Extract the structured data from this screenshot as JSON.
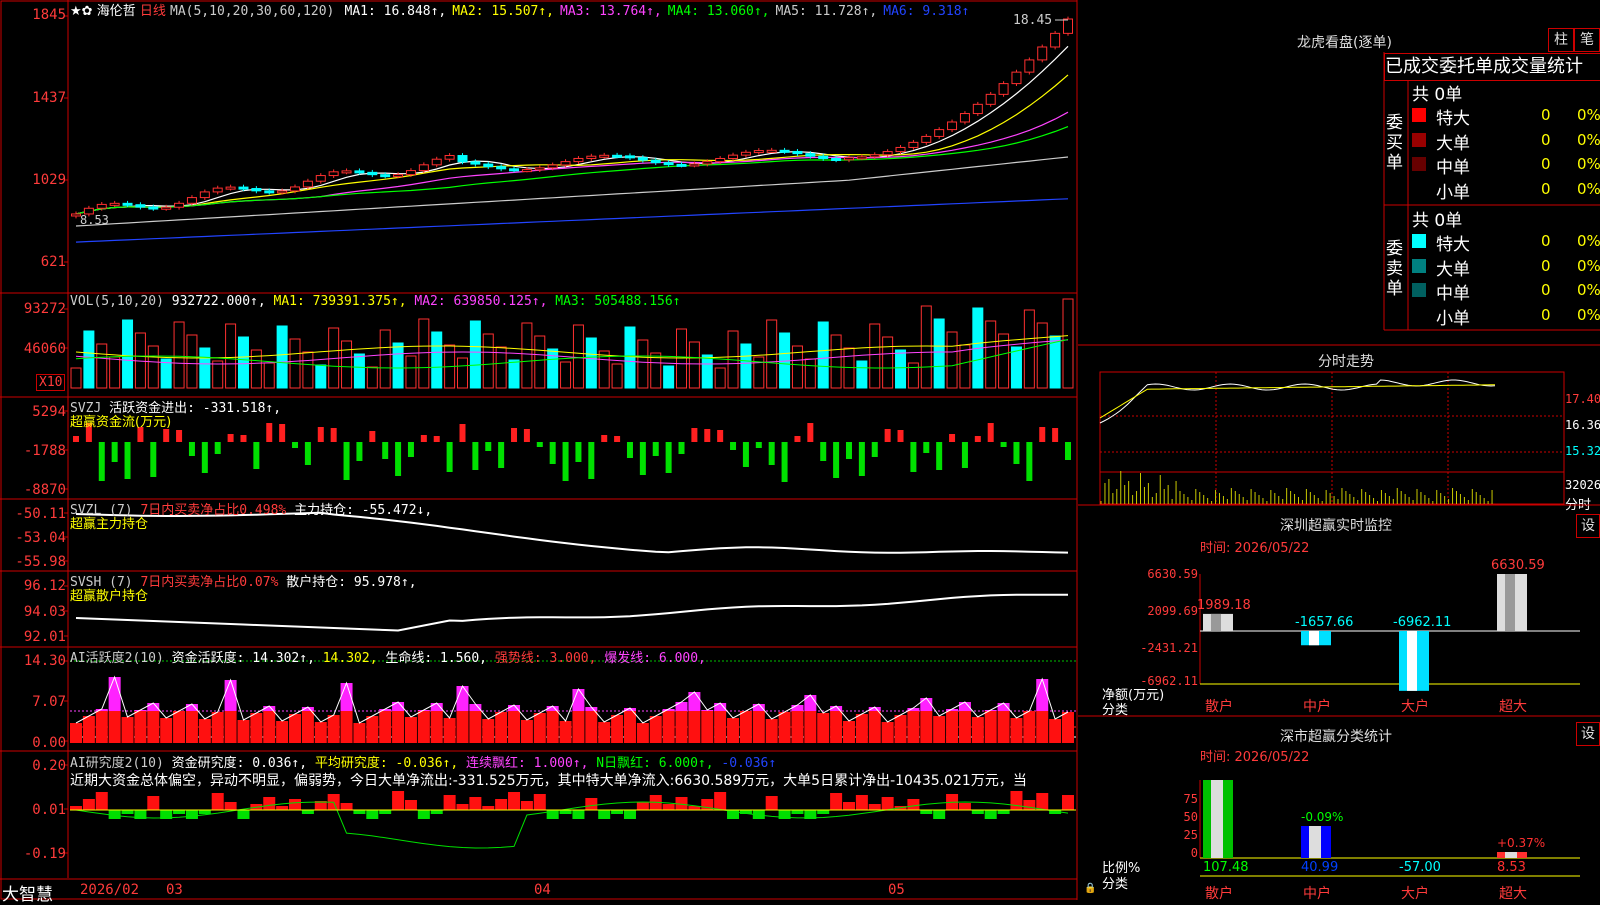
{
  "stock": {
    "name": "海伦哲",
    "period": "日线",
    "logo": "★✿"
  },
  "main": {
    "ma_label": "MA(5,10,20,30,60,120)",
    "ma": [
      {
        "t": "MA1: 16.848↑,",
        "c": "#ffffff"
      },
      {
        "t": "MA2: 15.507↑,",
        "c": "#ffff00"
      },
      {
        "t": "MA3: 13.764↑,",
        "c": "#ff44ff"
      },
      {
        "t": "MA4: 13.060↑,",
        "c": "#00ff00"
      },
      {
        "t": "MA5: 11.728↑,",
        "c": "#cccccc"
      },
      {
        "t": "MA6: 9.318↑",
        "c": "#2244ff"
      }
    ],
    "y_ticks": [
      "1845",
      "1437",
      "1029",
      "621"
    ],
    "high_label": "18.45",
    "low_label": "8.53"
  },
  "vol": {
    "label": "VOL(5,10,20)",
    "value": "932722.000↑,",
    "ma1": "MA1: 739391.375↑,",
    "ma2": "MA2: 639850.125↑,",
    "ma3": "MA3: 505488.156↑",
    "y_ticks": [
      "93272",
      "46060"
    ],
    "unit": "X10"
  },
  "svzj": {
    "label": "SVZJ",
    "text": "活跃资金进出: -331.518↑,",
    "sub": "超赢资金流(万元)",
    "y_ticks": [
      "5294",
      "-1788",
      "-8870"
    ]
  },
  "svzl": {
    "label": "SVZL (7)",
    "net": "7日内买卖净占比0.498%",
    "main": "主力持仓: -55.472↓,",
    "sub": "超赢主力持仓",
    "y_ticks": [
      "-50.11",
      "-53.04",
      "-55.98"
    ]
  },
  "svsh": {
    "label": "SVSH (7)",
    "net": "7日内买卖净占比0.07%",
    "retail": "散户持仓: 95.978↑,",
    "sub": "超赢散户持仓",
    "y_ticks": [
      "96.12",
      "94.03",
      "92.01"
    ]
  },
  "ai1": {
    "label": "AI活跃度2(10)",
    "fund": "资金活跃度: 14.302↑,",
    "v2": "14.302,",
    "life": "生命线: 1.560,",
    "strong": "强势线: 3.000,",
    "burst": "爆发线: 6.000,",
    "y_ticks": [
      "14.30",
      "7.07",
      "0.00"
    ]
  },
  "ai2": {
    "label": "AI研究度2(10)",
    "fund": "资金研究度: 0.036↑,",
    "avg": "平均研究度: -0.036↑,",
    "red": "连续飘红: 1.000↑,",
    "nred": "N日飘红: 6.000↑,",
    "neg": "-0.036↑",
    "comment": "近期大资金总体偏空，异动不明显，偏弱势，今日大单净流出:-331.525万元，其中特大单净流入:6630.589万元，大单5日累计净出-10435.021万元，当",
    "y_ticks": [
      "0.20",
      "0.01",
      "-0.19"
    ]
  },
  "date_axis": {
    "items": [
      "2026/02",
      "03",
      "04",
      "05"
    ],
    "brand": "大智慧"
  },
  "right": {
    "lhb_title": "龙虎看盘(逐单)",
    "btn_zhu": "柱",
    "btn_bi": "笔",
    "tabs": "已成交委托单成交量统计",
    "buy": {
      "side": "委买单",
      "total": "共 0单",
      "rows": [
        {
          "name": "特大",
          "n": "0",
          "p": "0%",
          "c": "#ff0000"
        },
        {
          "name": "大单",
          "n": "0",
          "p": "0%",
          "c": "#990000"
        },
        {
          "name": "中单",
          "n": "0",
          "p": "0%",
          "c": "#660000"
        },
        {
          "name": "小单",
          "n": "0",
          "p": "0%",
          "c": ""
        }
      ]
    },
    "sell": {
      "side": "委卖单",
      "total": "共 0单",
      "rows": [
        {
          "name": "特大",
          "n": "0",
          "p": "0%",
          "c": "#00ffff"
        },
        {
          "name": "大单",
          "n": "0",
          "p": "0%",
          "c": "#008080"
        },
        {
          "name": "中单",
          "n": "0",
          "p": "0%",
          "c": "#006060"
        },
        {
          "name": "小单",
          "n": "0",
          "p": "0%",
          "c": ""
        }
      ]
    },
    "fs": {
      "title": "分时走势",
      "y": [
        "17.40",
        "16.36",
        "15.32"
      ],
      "vol_y": "32026",
      "unit": "分时"
    },
    "sz_monitor": {
      "title": "深圳超赢实时监控",
      "set": "设",
      "time": "时间: 2026/05/22",
      "y": [
        "6630.59",
        "2099.69",
        "-2431.21",
        "-6962.11"
      ],
      "bars": [
        {
          "name": "散户",
          "v": "1989.18",
          "val": 1989.18
        },
        {
          "name": "中户",
          "v": "-1657.66",
          "val": -1657.66
        },
        {
          "name": "大户",
          "v": "-6962.11",
          "val": -6962.11
        },
        {
          "name": "超大",
          "v": "6630.59",
          "val": 6630.59
        }
      ],
      "ylabel": "净额(万元)",
      "xlabel": "分类"
    },
    "sz_class": {
      "title": "深市超赢分类统计",
      "set": "设",
      "time": "时间: 2026/05/22",
      "y": [
        "75",
        "50",
        "25",
        "0"
      ],
      "bars": [
        {
          "name": "散户",
          "v": "107.48",
          "top": ""
        },
        {
          "name": "中户",
          "v": "40.99",
          "top": "-0.09%"
        },
        {
          "name": "大户",
          "v": "-57.00",
          "top": ""
        },
        {
          "name": "超大",
          "v": "8.53",
          "top": "+0.37%"
        }
      ],
      "ylabel": "比例%",
      "xlabel": "分类"
    }
  }
}
